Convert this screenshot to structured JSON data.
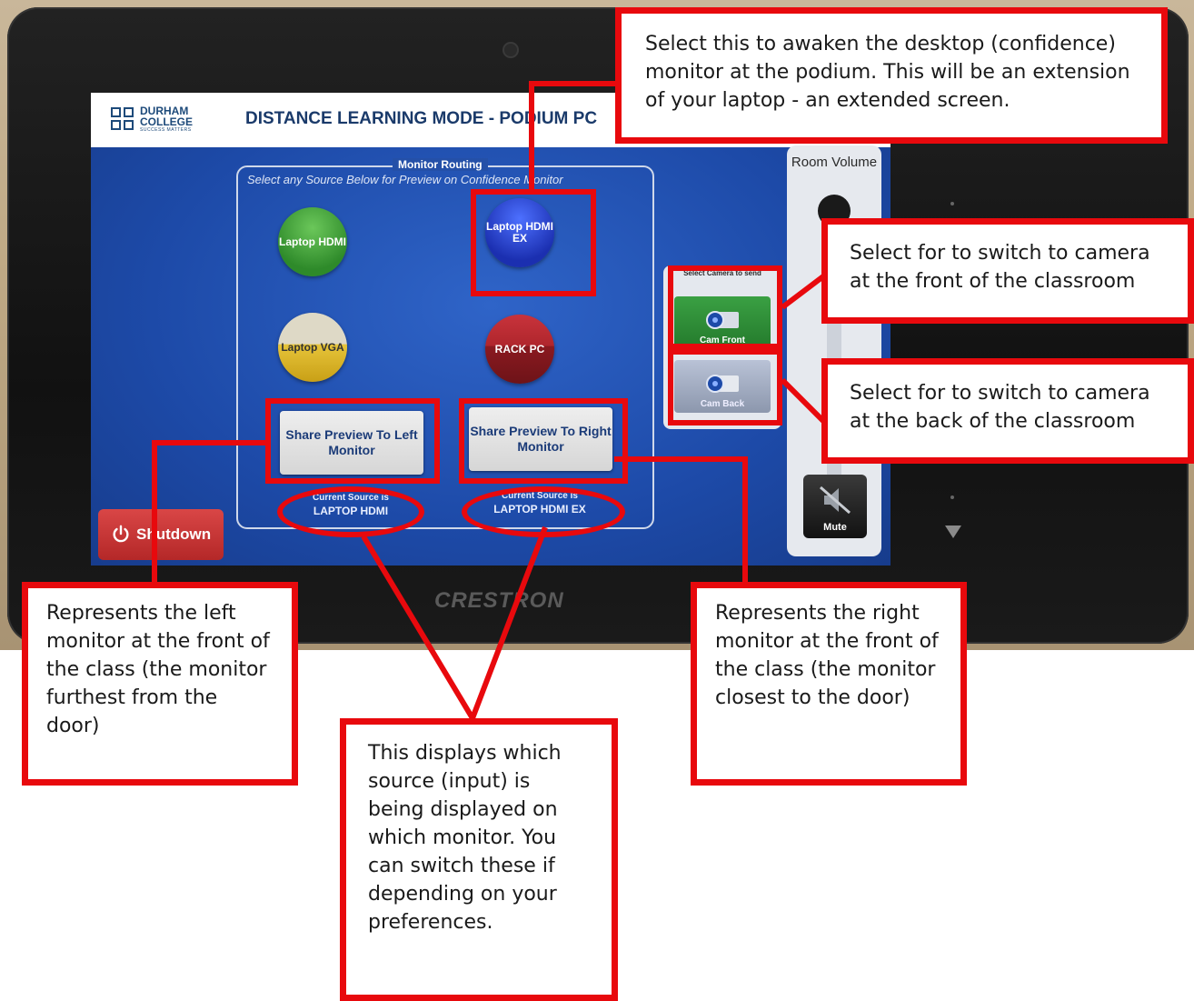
{
  "panel": {
    "brand": "CRESTRON",
    "logo_line1": "DURHAM",
    "logo_line2": "COLLEGE",
    "logo_tagline": "SUCCESS MATTERS",
    "header_title": "DISTANCE LEARNING MODE - PODIUM PC",
    "routing_title": "Monitor Routing",
    "routing_subtitle": "Select any Source Below for Preview on Confidence Monitor",
    "sources": [
      {
        "label": "Laptop HDMI",
        "color": "#2e8a2a"
      },
      {
        "label": "Laptop HDMI EX",
        "color": "#1b2fb0"
      },
      {
        "label": "Laptop VGA",
        "color": "#c9a016"
      },
      {
        "label": "RACK PC",
        "color": "#b0262d"
      }
    ],
    "share_left": "Share Preview To Left Monitor",
    "share_right": "Share Preview To Right Monitor",
    "current_left_caption": "Current Source is",
    "current_left_value": "LAPTOP HDMI",
    "current_right_caption": "Current Source is",
    "current_right_value": "LAPTOP HDMI EX",
    "shutdown_label": "Shutdown",
    "camera_header": "Select Camera to send",
    "cam_front_label": "Cam Front",
    "cam_back_label": "Cam Back",
    "volume_label": "Room Volume",
    "mute_label": "Mute"
  },
  "annotations": {
    "confidence_monitor": "Select this to awaken the desktop (confidence) monitor at the podium. This will be an extension of your laptop - an extended screen.",
    "cam_front": "Select for to switch to camera at the front of the classroom",
    "cam_back": "Select for to switch to camera at the back of the classroom",
    "left_monitor": "Represents the left monitor at the front of the class (the monitor furthest from the door)",
    "right_monitor": "Represents the right monitor at the front of the class (the monitor closest to the door)",
    "current_source": "This displays which source (input) is being displayed on which monitor. You can switch these if depending on your preferences."
  },
  "colors": {
    "annotation_red": "#e8090d",
    "screen_blue": "#1d4aa8"
  }
}
